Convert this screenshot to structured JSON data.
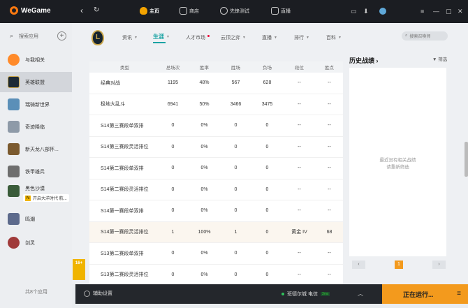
{
  "app": {
    "title": "WeGame"
  },
  "topnav": [
    {
      "label": "主页",
      "icon": "mascot-icon",
      "active": true
    },
    {
      "label": "商店",
      "icon": "store-icon"
    },
    {
      "label": "先锋测试",
      "icon": "gamepad-icon"
    },
    {
      "label": "直播",
      "icon": "live-tv-icon"
    }
  ],
  "sidebar": {
    "search_label": "搜索应用",
    "items": [
      {
        "label": "与我相关",
        "color": "#ff8a2a"
      },
      {
        "label": "英雄联盟",
        "color": "#1d2a36",
        "active": true
      },
      {
        "label": "瑞骑新世界",
        "color": "#5b8fb8"
      },
      {
        "label": "奇迹降临",
        "color": "#8e9aa8"
      },
      {
        "label": "新天龙八部怀...",
        "color": "#7b5a2f"
      },
      {
        "label": "铁甲雄兵",
        "color": "#6e6e6e"
      },
      {
        "label": "黑色沙漠",
        "color": "#3a5c3a"
      },
      {
        "label": "鸣潮",
        "color": "#5d6a8c"
      },
      {
        "label": "剑灵",
        "color": "#a03a3a"
      }
    ],
    "badge_text": "开启大洋时代 航...",
    "count_text": "共8个应用"
  },
  "tabs": [
    {
      "label": "资讯",
      "chev": true
    },
    {
      "label": "生涯",
      "chev": true,
      "active": true
    },
    {
      "label": "人才市场",
      "dot": true
    },
    {
      "label": "云顶之弈",
      "chev": true
    },
    {
      "label": "直播",
      "chev": true
    },
    {
      "label": "排行",
      "chev": true
    },
    {
      "label": "百科",
      "chev": true
    }
  ],
  "search_placeholder": "搜索召唤师",
  "table": {
    "headers": [
      "类型",
      "总场次",
      "胜率",
      "胜场",
      "负场",
      "段位",
      "胜点"
    ],
    "rows": [
      [
        "经典对战",
        "1195",
        "48%",
        "567",
        "628",
        "--",
        "--"
      ],
      [
        "极地大乱斗",
        "6941",
        "50%",
        "3466",
        "3475",
        "--",
        "--"
      ],
      [
        "S14第三赛段单双排",
        "0",
        "0%",
        "0",
        "0",
        "--",
        "--"
      ],
      [
        "S14第三赛段灵活排位",
        "0",
        "0%",
        "0",
        "0",
        "--",
        "--"
      ],
      [
        "S14第二赛段单双排",
        "0",
        "0%",
        "0",
        "0",
        "--",
        "--"
      ],
      [
        "S14第二赛段灵活排位",
        "0",
        "0%",
        "0",
        "0",
        "--",
        "--"
      ],
      [
        "S14第一赛段单双排",
        "0",
        "0%",
        "0",
        "0",
        "--",
        "--"
      ],
      [
        "S14第一赛段灵活排位",
        "1",
        "100%",
        "1",
        "0",
        "黄金 IV",
        "68"
      ],
      [
        "S13第二赛段单双排",
        "0",
        "0%",
        "0",
        "0",
        "--",
        "--"
      ],
      [
        "S13第二赛段灵活排位",
        "0",
        "0%",
        "0",
        "0",
        "--",
        "--"
      ]
    ]
  },
  "history": {
    "title": "历史战绩",
    "filter_label": "筛选",
    "empty_line1": "最近没有相关战绩",
    "empty_line2": "请重新筛选",
    "page": "1"
  },
  "bottombar": {
    "help_label": "辅助设置",
    "server": "班德尔城 电信",
    "server_tag": "3ms",
    "run_label": "正在运行..."
  },
  "age_badge": "16+"
}
